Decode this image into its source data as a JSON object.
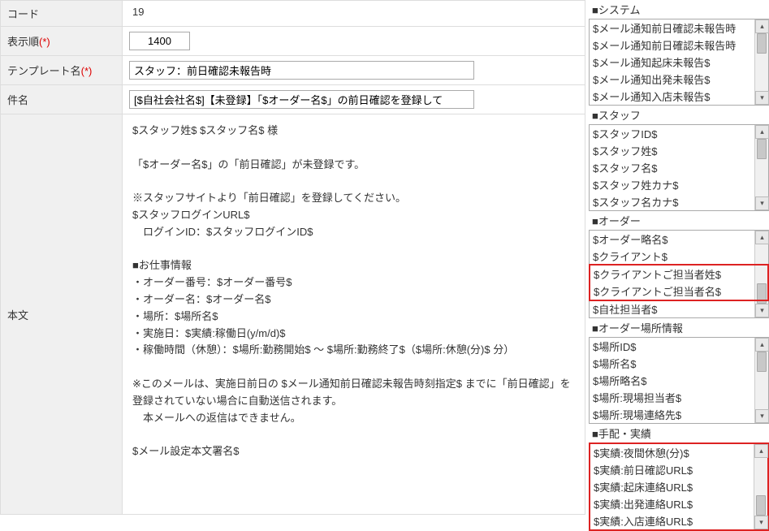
{
  "form": {
    "code_label": "コード",
    "code_value": "19",
    "order_label": "表示順",
    "order_req": "(*)",
    "order_value": "1400",
    "tmplname_label": "テンプレート名",
    "tmplname_req": "(*)",
    "tmplname_value": "スタッフ：前日確認未報告時",
    "subject_label": "件名",
    "subject_value": "[$自社会社名$]【未登録】「$オーダー名$」の前日確認を登録して",
    "body_label": "本文",
    "body_text": "$スタッフ姓$ $スタッフ名$ 様\n\n「$オーダー名$」の「前日確認」が未登録です。\n\n※スタッフサイトより「前日確認」を登録してください。\n$スタッフログインURL$\n　ログインID：$スタッフログインID$\n\n■お仕事情報\n・オーダー番号：$オーダー番号$\n・オーダー名：$オーダー名$\n・場所：$場所名$\n・実施日：$実績:稼働日(y/m/d)$\n・稼働時間（休憩）：$場所:勤務開始$ ～ $場所:勤務終了$（$場所:休憩(分)$ 分）\n\n※このメールは、実施日前日の $メール通知前日確認未報告時刻指定$ までに「前日確認」を登録されていない場合に自動送信されます。\n　本メールへの返信はできません。\n\n$メール設定本文署名$"
  },
  "sections": {
    "system": {
      "title": "■システム",
      "items": [
        "$メール通知前日確認未報告時",
        "$メール通知前日確認未報告時",
        "$メール通知起床未報告$",
        "$メール通知出発未報告$",
        "$メール通知入店未報告$"
      ]
    },
    "staff": {
      "title": "■スタッフ",
      "items": [
        "$スタッフID$",
        "$スタッフ姓$",
        "$スタッフ名$",
        "$スタッフ姓カナ$",
        "$スタッフ名カナ$"
      ]
    },
    "order": {
      "title": "■オーダー",
      "items_top": [
        "$オーダー略名$",
        "$クライアント$"
      ],
      "items_highlight": [
        "$クライアントご担当者姓$",
        "$クライアントご担当者名$"
      ],
      "items_bottom": [
        "$自社担当者$"
      ]
    },
    "place": {
      "title": "■オーダー場所情報",
      "items": [
        "$場所ID$",
        "$場所名$",
        "$場所略名$",
        "$場所:現場担当者$",
        "$場所:現場連絡先$"
      ]
    },
    "results": {
      "title": "■手配・実績",
      "items": [
        "$実績:夜間休憩(分)$",
        "$実績:前日確認URL$",
        "$実績:起床連絡URL$",
        "$実績:出発連絡URL$",
        "$実績:入店連絡URL$"
      ]
    }
  }
}
